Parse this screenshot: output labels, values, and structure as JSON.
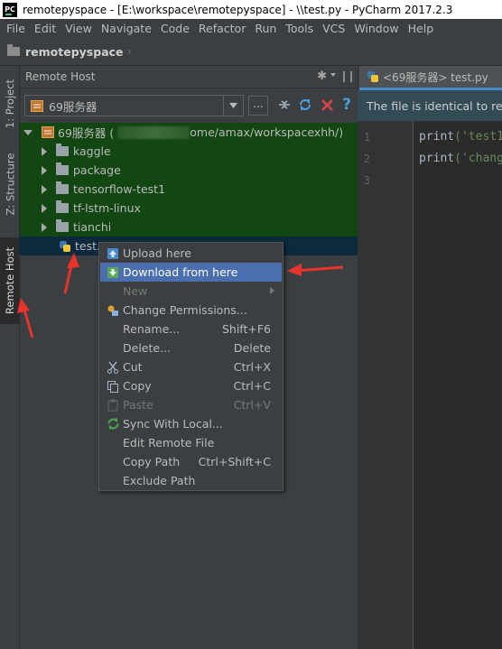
{
  "window": {
    "title": "remotepyspace - [E:\\workspace\\remotepyspace] - \\\\test.py - PyCharm 2017.2.3",
    "logo_text": "PC"
  },
  "menu": [
    {
      "label": "File"
    },
    {
      "label": "Edit"
    },
    {
      "label": "View"
    },
    {
      "label": "Navigate"
    },
    {
      "label": "Code"
    },
    {
      "label": "Refactor"
    },
    {
      "label": "Run"
    },
    {
      "label": "Tools"
    },
    {
      "label": "VCS"
    },
    {
      "label": "Window"
    },
    {
      "label": "Help"
    }
  ],
  "navbar": {
    "project": "remotepyspace",
    "chevron": "›"
  },
  "left_stripe": {
    "tabs": [
      {
        "label": "1: Project",
        "icon": "project-folder-icon"
      },
      {
        "label": "Z: Structure",
        "icon": "structure-icon"
      },
      {
        "label": "Remote Host",
        "icon": "remote-host-icon"
      }
    ]
  },
  "remote_panel": {
    "title": "Remote Host",
    "server_combo_value": "69服务器",
    "ellipsis": "...",
    "toolbar_icons": [
      "settings-icon",
      "pin-icon",
      "collapse-icon",
      "refresh-icon",
      "close-icon",
      "help-icon"
    ],
    "tree": {
      "root_name": "69服务器 (",
      "root_path_visible": "ome/amax/workspacexhh/)",
      "folders": [
        "kaggle",
        "package",
        "tensorflow-test1",
        "tf-lstm-linux",
        "tianchi"
      ],
      "selected_file": "test.py"
    }
  },
  "editor": {
    "tab_label": "<69服务器> test.py",
    "notice": "The file is identical to rem",
    "line_numbers": [
      "1",
      "2",
      "3"
    ],
    "code_lines": [
      {
        "fn": "print",
        "arg": "('test1"
      },
      {
        "fn": "print",
        "arg": "('chang"
      }
    ]
  },
  "context_menu": {
    "items": [
      {
        "label": "Upload here",
        "shortcut": "",
        "icon": "upload-icon",
        "state": "normal"
      },
      {
        "label": "Download from here",
        "shortcut": "",
        "icon": "download-icon",
        "state": "selected"
      },
      {
        "label": "New",
        "shortcut": "",
        "icon": "",
        "state": "disabled",
        "submenu": true
      },
      {
        "label": "Change Permissions...",
        "shortcut": "",
        "icon": "permissions-icon",
        "state": "normal"
      },
      {
        "label": "Rename...",
        "shortcut": "Shift+F6",
        "icon": "",
        "state": "normal"
      },
      {
        "label": "Delete...",
        "shortcut": "Delete",
        "icon": "",
        "state": "normal"
      },
      {
        "label": "Cut",
        "shortcut": "Ctrl+X",
        "icon": "scissors-icon",
        "state": "normal"
      },
      {
        "label": "Copy",
        "shortcut": "Ctrl+C",
        "icon": "copy-icon",
        "state": "normal"
      },
      {
        "label": "Paste",
        "shortcut": "Ctrl+V",
        "icon": "paste-icon",
        "state": "disabled"
      },
      {
        "label": "Sync With Local...",
        "shortcut": "",
        "icon": "sync-icon",
        "state": "normal"
      },
      {
        "label": "Edit Remote File",
        "shortcut": "",
        "icon": "",
        "state": "normal"
      },
      {
        "label": "Copy Path",
        "shortcut": "Ctrl+Shift+C",
        "icon": "",
        "state": "normal"
      },
      {
        "label": "Exclude Path",
        "shortcut": "",
        "icon": "",
        "state": "normal"
      }
    ]
  },
  "colors": {
    "accent_selection": "#4b6eaf",
    "annotation_red": "#e8332a",
    "tree_highlight_green": "#124612"
  }
}
